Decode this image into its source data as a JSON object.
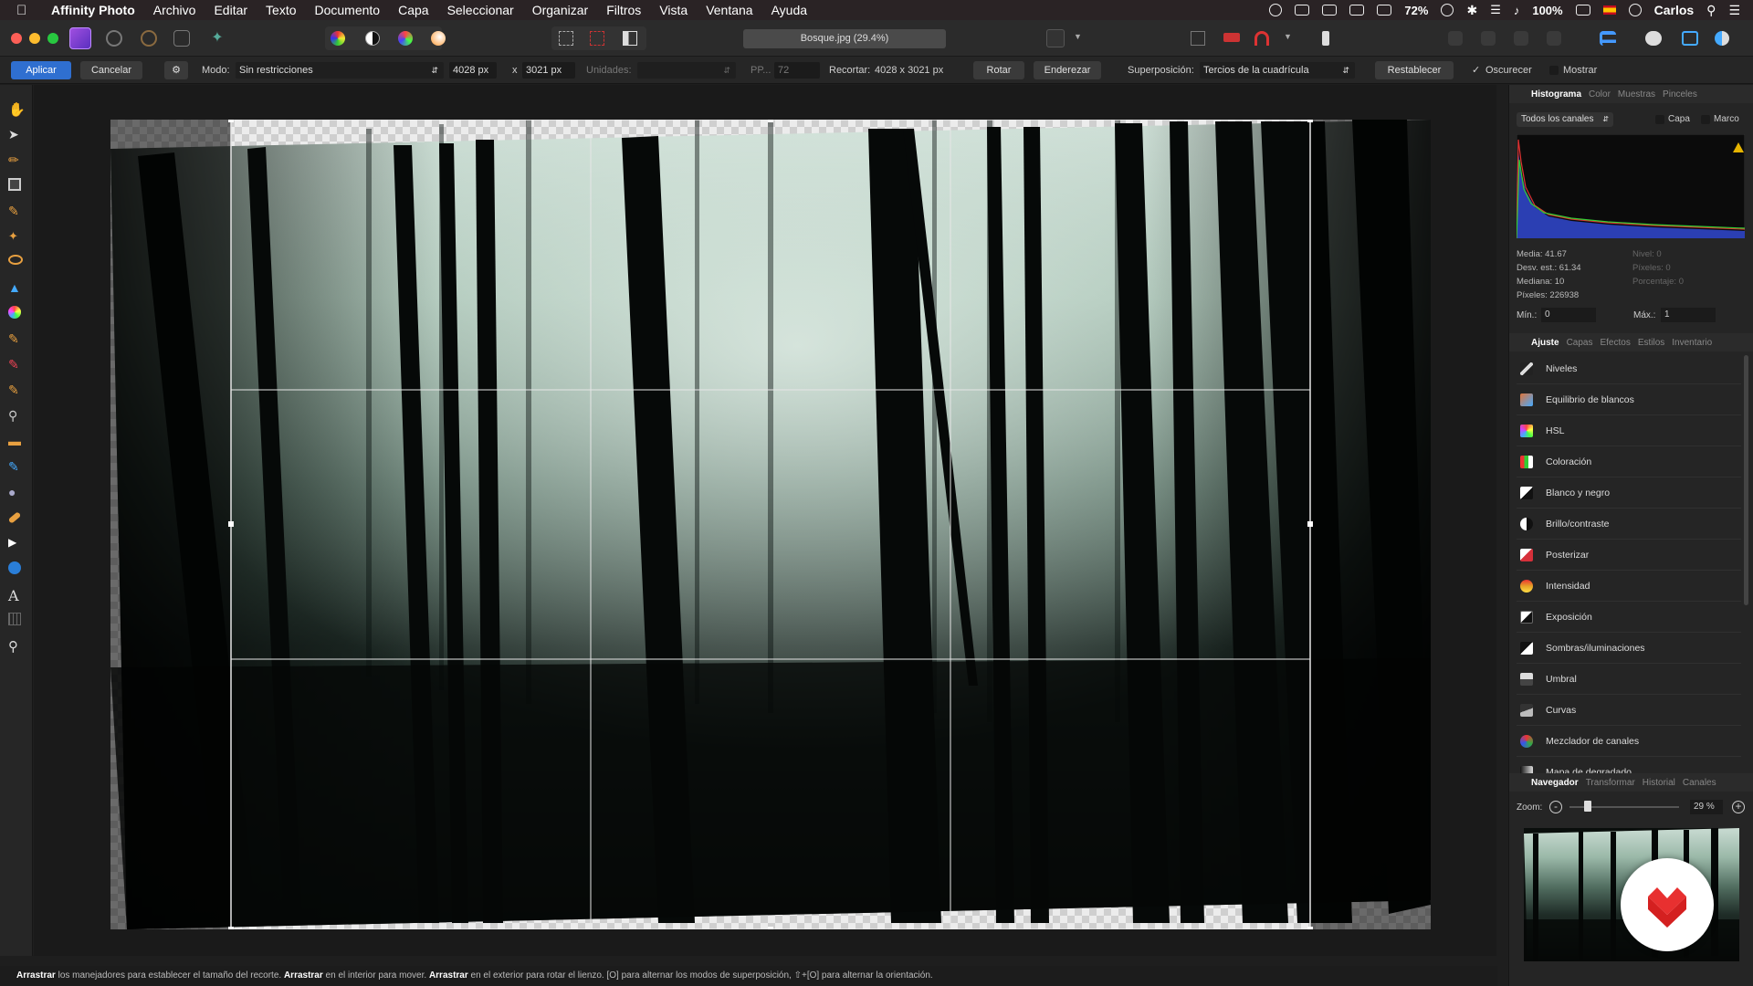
{
  "menubar": {
    "app_name": "Affinity Photo",
    "items": [
      "Archivo",
      "Editar",
      "Texto",
      "Documento",
      "Capa",
      "Seleccionar",
      "Organizar",
      "Filtros",
      "Vista",
      "Ventana",
      "Ayuda"
    ],
    "battery_pct": "72%",
    "volume_pct": "100%",
    "user": "Carlos"
  },
  "document": {
    "tab_title": "Bosque.jpg (29.4%)"
  },
  "context": {
    "apply": "Aplicar",
    "cancel": "Cancelar",
    "mode_label": "Modo:",
    "mode_value": "Sin restricciones",
    "width": "4028 px",
    "times": "x",
    "height": "3021 px",
    "units_label": "Unidades:",
    "ppi_label": "PP...",
    "ppi_value": "72",
    "crop_label": "Recortar:",
    "crop_value": "4028 x 3021 px",
    "rotate": "Rotar",
    "straighten": "Enderezar",
    "overlay_label": "Superposición:",
    "overlay_value": "Tercios de la cuadrícula",
    "reset": "Restablecer",
    "darken": "Oscurecer",
    "show": "Mostrar"
  },
  "histogram": {
    "tabs": [
      "Histograma",
      "Color",
      "Muestras",
      "Pinceles"
    ],
    "channels": "Todos los canales",
    "layer": "Capa",
    "frame": "Marco",
    "stats_left": [
      "Media: 41.67",
      "Desv. est.: 61.34",
      "Mediana: 10",
      "Píxeles: 226938"
    ],
    "stats_right": [
      "Nivel: 0",
      "Píxeles: 0",
      "Porcentaje: 0"
    ],
    "min_label": "Mín.:",
    "min_value": "0",
    "max_label": "Máx.:",
    "max_value": "1"
  },
  "adjustments": {
    "tabs": [
      "Ajuste",
      "Capas",
      "Efectos",
      "Estilos",
      "Inventario"
    ],
    "items": [
      {
        "label": "Niveles",
        "icon": "levels-icon",
        "color": "#cccccc"
      },
      {
        "label": "Equilibrio de blancos",
        "icon": "white-balance-icon",
        "color": "#e0743a"
      },
      {
        "label": "HSL",
        "icon": "hsl-icon",
        "color": "#c64fd8"
      },
      {
        "label": "Coloración",
        "icon": "recolor-icon",
        "color": "#4ea84a"
      },
      {
        "label": "Blanco y negro",
        "icon": "black-white-icon",
        "color": "#eeeeee"
      },
      {
        "label": "Brillo/contraste",
        "icon": "brightness-contrast-icon",
        "color": "#dddddd"
      },
      {
        "label": "Posterizar",
        "icon": "posterize-icon",
        "color": "#d6303a"
      },
      {
        "label": "Intensidad",
        "icon": "vibrance-icon",
        "color": "#e7a127"
      },
      {
        "label": "Exposición",
        "icon": "exposure-icon",
        "color": "#dddddd"
      },
      {
        "label": "Sombras/iluminaciones",
        "icon": "shadows-highlights-icon",
        "color": "#dddddd"
      },
      {
        "label": "Umbral",
        "icon": "threshold-icon",
        "color": "#aaaaaa"
      },
      {
        "label": "Curvas",
        "icon": "curves-icon",
        "color": "#bbbbbb"
      },
      {
        "label": "Mezclador de canales",
        "icon": "channel-mixer-icon",
        "color": "#3fa34a"
      },
      {
        "label": "Mapa de degradado",
        "icon": "gradient-map-icon",
        "color": "#999999"
      }
    ]
  },
  "navigator": {
    "tabs": [
      "Navegador",
      "Transformar",
      "Historial",
      "Canales"
    ],
    "zoom_label": "Zoom:",
    "zoom_value": "29 %"
  },
  "status": {
    "parts": [
      {
        "b": "Arrastrar",
        "t": " los manejadores para establecer el tamaño del recorte. "
      },
      {
        "b": "Arrastrar",
        "t": " en el interior para mover. "
      },
      {
        "b": "Arrastrar",
        "t": " en el exterior para rotar el lienzo. [O] para alternar los modos de superposición, ⇧+[O] para alternar la orientación."
      }
    ]
  }
}
